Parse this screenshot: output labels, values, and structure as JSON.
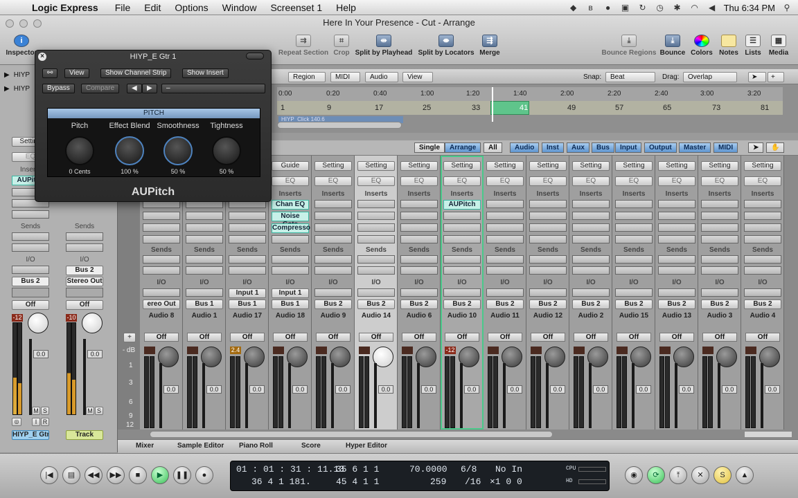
{
  "menubar": {
    "app": "Logic Express",
    "items": [
      "File",
      "Edit",
      "Options",
      "Window",
      "Screenset 1",
      "Help"
    ],
    "clock": "Thu 6:34 PM"
  },
  "window": {
    "title": "Here In Your Presence - Cut - Arrange"
  },
  "toolbar": {
    "left_label": "Inspector",
    "items": [
      "Repeat Section",
      "Crop",
      "Split by Playhead",
      "Split by Locators",
      "Merge"
    ],
    "right_items": [
      "Bounce Regions",
      "Bounce",
      "Colors",
      "Notes",
      "Lists",
      "Media"
    ]
  },
  "arrange_bar": {
    "menus": [
      "Region",
      "MIDI",
      "Audio",
      "View"
    ],
    "snap_label": "Snap:",
    "snap_value": "Beat",
    "drag_label": "Drag:",
    "drag_value": "Overlap"
  },
  "ruler": {
    "times": [
      "0:00",
      "0:20",
      "0:40",
      "1:00",
      "1:20",
      "1:40",
      "2:00",
      "2:20",
      "2:40",
      "3:00",
      "3:20"
    ],
    "bars": [
      "1",
      "9",
      "17",
      "25",
      "33",
      "41",
      "49",
      "57",
      "65",
      "73",
      "81"
    ],
    "region": "HIYP_Click 140.6"
  },
  "left_tracks": [
    "HIYP",
    "HIYP"
  ],
  "inspector": {
    "strip1": {
      "setting": "Setting",
      "eq": "EQ",
      "inserts": "Inserts",
      "plugin": "AUPitch",
      "sends": "Sends",
      "io": "I/O",
      "bus": "Bus 2",
      "off": "Off",
      "peak": "-12",
      "value": "0.0",
      "name": "HIYP_E Gtr"
    },
    "strip2": {
      "sends": "Sends",
      "io": "I/O",
      "bus": "Bus 2",
      "output": "Stereo Out",
      "off": "Off",
      "peak": "-10",
      "value": "0.0",
      "name": "Track"
    }
  },
  "mixer": {
    "view_buttons": [
      "Single",
      "Arrange",
      "All"
    ],
    "filter_buttons": [
      "Audio",
      "Inst",
      "Aux",
      "Bus",
      "Input",
      "Output",
      "Master",
      "MIDI"
    ],
    "strips": [
      {
        "name": "Audio 8",
        "output": "ereo Out",
        "input": "",
        "peak": "",
        "value": "0.0",
        "plugins": []
      },
      {
        "name": "Audio 1",
        "output": "Bus 1",
        "input": "",
        "peak": "",
        "value": "0.0",
        "plugins": []
      },
      {
        "name": "Audio 17",
        "output": "Bus 1",
        "input": "Input 1",
        "peak": "2.4",
        "value": "0.0",
        "plugins": []
      },
      {
        "name": "Audio 18",
        "output": "Bus 1",
        "input": "Input 1",
        "peak": "",
        "value": "0.0",
        "plugins": [
          "Chan EQ",
          "Noise Gate",
          "Compresso"
        ],
        "setting": "Guide"
      },
      {
        "name": "Audio 9",
        "output": "Bus 2",
        "input": "",
        "peak": "",
        "value": "0.0",
        "plugins": []
      },
      {
        "name": "Audio 14",
        "output": "Bus 2",
        "input": "",
        "peak": "",
        "value": "0.0",
        "plugins": []
      },
      {
        "name": "Audio 6",
        "output": "Bus 2",
        "input": "",
        "peak": "",
        "value": "0.0",
        "plugins": []
      },
      {
        "name": "Audio 10",
        "output": "Bus 2",
        "input": "",
        "peak": "-12",
        "value": "0.0",
        "plugins": [
          "AUPitch"
        ]
      },
      {
        "name": "Audio 11",
        "output": "Bus 2",
        "input": "",
        "peak": "",
        "value": "0.0",
        "plugins": []
      },
      {
        "name": "Audio 12",
        "output": "Bus 2",
        "input": "",
        "peak": "",
        "value": "0.0",
        "plugins": []
      },
      {
        "name": "Audio 2",
        "output": "Bus 2",
        "input": "",
        "peak": "",
        "value": "0.0",
        "plugins": []
      },
      {
        "name": "Audio 15",
        "output": "Bus 2",
        "input": "",
        "peak": "",
        "value": "0.0",
        "plugins": []
      },
      {
        "name": "Audio 13",
        "output": "Bus 2",
        "input": "",
        "peak": "",
        "value": "0.0",
        "plugins": []
      },
      {
        "name": "Audio 3",
        "output": "Bus 2",
        "input": "",
        "peak": "",
        "value": "0.0",
        "plugins": []
      },
      {
        "name": "Audio 4",
        "output": "Bus 2",
        "input": "",
        "peak": "",
        "value": "0.0",
        "plugins": []
      }
    ],
    "labels": {
      "setting": "Setting",
      "eq": "EQ",
      "inserts": "Inserts",
      "sends": "Sends",
      "io": "I/O",
      "off": "Off"
    },
    "scale": [
      "- dB",
      "1",
      "3",
      "6",
      "9",
      "12"
    ]
  },
  "bottom_tabs": [
    "Mixer",
    "Sample Editor",
    "Piano Roll",
    "Score",
    "Hyper Editor"
  ],
  "transport": {
    "smpte": "01 : 01 : 31 : 11.13",
    "bars": "36    4    1  181.",
    "locator_left": "35    6    1    1",
    "locator_right": "45    4    1    1",
    "tempo": "70.0000",
    "division": "259",
    "signature": "6/8",
    "sig_div": "/16",
    "in_label": "No In",
    "out_label": "×1    0    0",
    "cpu": "CPU",
    "hd": "HD"
  },
  "plugin": {
    "title": "HIYP_E Gtr 1",
    "view": "View",
    "show_strip": "Show Channel Strip",
    "show_insert": "Show Insert",
    "bypass": "Bypass",
    "compare": "Compare",
    "preset": "–",
    "panel_title": "PITCH",
    "params": [
      {
        "label": "Pitch",
        "value": "0",
        "unit": "Cents"
      },
      {
        "label": "Effect Blend",
        "value": "100",
        "unit": "%"
      },
      {
        "label": "Smoothness",
        "value": "50",
        "unit": "%"
      },
      {
        "label": "Tightness",
        "value": "50",
        "unit": "%"
      }
    ],
    "name": "AUPitch"
  }
}
